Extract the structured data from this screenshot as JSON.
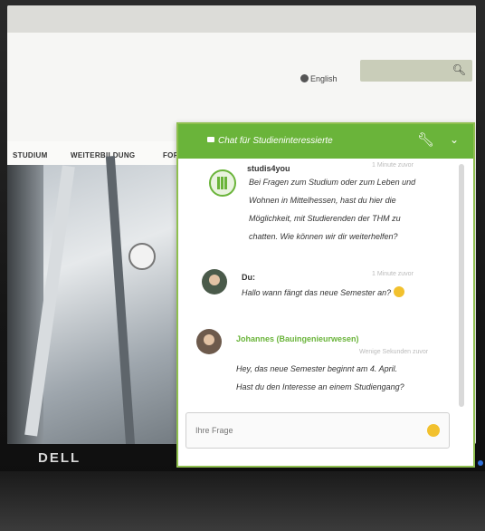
{
  "site": {
    "language": "English",
    "nav": [
      "STUDIUM",
      "WEITERBILDUNG",
      "FORSCHU"
    ]
  },
  "monitor": {
    "brand": "DELL"
  },
  "chat": {
    "title": "Chat für Studieninteressierte",
    "messages": [
      {
        "author": "studis4you",
        "time": "1 Minute zuvor",
        "lines": [
          "Bei Fragen zum Studium oder zum Leben und",
          "Wohnen in Mittelhessen, hast du hier die",
          "Möglichkeit, mit Studierenden der THM zu",
          "chatten. Wie können wir dir weiterhelfen?"
        ]
      },
      {
        "author": "Du:",
        "time": "1 Minute zuvor",
        "lines": [
          "Hallo wann fängt das neue Semester an?"
        ]
      },
      {
        "author": "Johannes (Bauingenieurwesen)",
        "time": "Wenige Sekunden zuvor",
        "lines": [
          "Hey, das neue Semester beginnt am 4. April.",
          "Hast du den Interesse an einem Studiengang?"
        ]
      }
    ],
    "input_placeholder": "Ihre Frage"
  },
  "colors": {
    "accent": "#6ab43a",
    "search": "#c9cdb9"
  }
}
